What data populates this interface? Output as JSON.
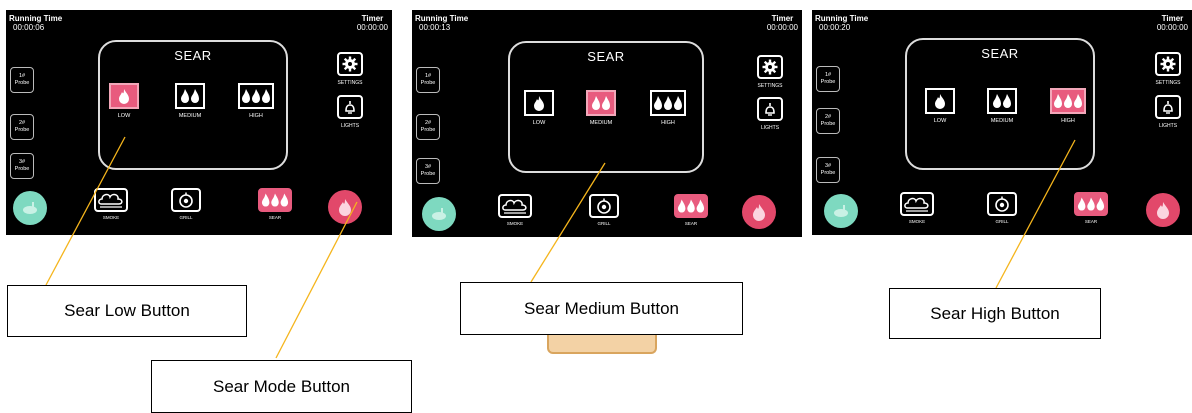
{
  "screens": [
    {
      "running_time_label": "Running Time",
      "running_time_value": "00:00:06",
      "timer_label": "Timer",
      "timer_value": "00:00:00",
      "probes": [
        "1#\nProbe",
        "2#\nProbe",
        "3#\nProbe"
      ],
      "sear_title": "SEAR",
      "levels": [
        "LOW",
        "MEDIUM",
        "HIGH"
      ],
      "active_level": "LOW",
      "settings_label": "SETTINGS",
      "lights_label": "LIGHTS",
      "modes": [
        "SMOKE",
        "GRILL",
        "SEAR"
      ]
    },
    {
      "running_time_label": "Running Time",
      "running_time_value": "00:00:13",
      "timer_label": "Timer",
      "timer_value": "00:00:00",
      "probes": [
        "1#\nProbe",
        "2#\nProbe",
        "3#\nProbe"
      ],
      "sear_title": "SEAR",
      "levels": [
        "LOW",
        "MEDIUM",
        "HIGH"
      ],
      "active_level": "MEDIUM",
      "settings_label": "SETTINGS",
      "lights_label": "LIGHTS",
      "modes": [
        "SMOKE",
        "GRILL",
        "SEAR"
      ]
    },
    {
      "running_time_label": "Running Time",
      "running_time_value": "00:00:20",
      "timer_label": "Timer",
      "timer_value": "00:00:00",
      "probes": [
        "1#\nProbe",
        "2#\nProbe",
        "3#\nProbe"
      ],
      "sear_title": "SEAR",
      "levels": [
        "LOW",
        "MEDIUM",
        "HIGH"
      ],
      "active_level": "HIGH",
      "settings_label": "SETTINGS",
      "lights_label": "LIGHTS",
      "modes": [
        "SMOKE",
        "GRILL",
        "SEAR"
      ]
    }
  ],
  "callouts": {
    "sear_low": "Sear Low Button",
    "sear_medium": "Sear Medium Button",
    "sear_high": "Sear High Button",
    "sear_mode": "Sear Mode Button"
  },
  "colors": {
    "active_pink": "#e85b7e",
    "mode_green": "#7ed9c0",
    "mode_red": "#e2486a",
    "leader_line": "#f5b51c"
  }
}
